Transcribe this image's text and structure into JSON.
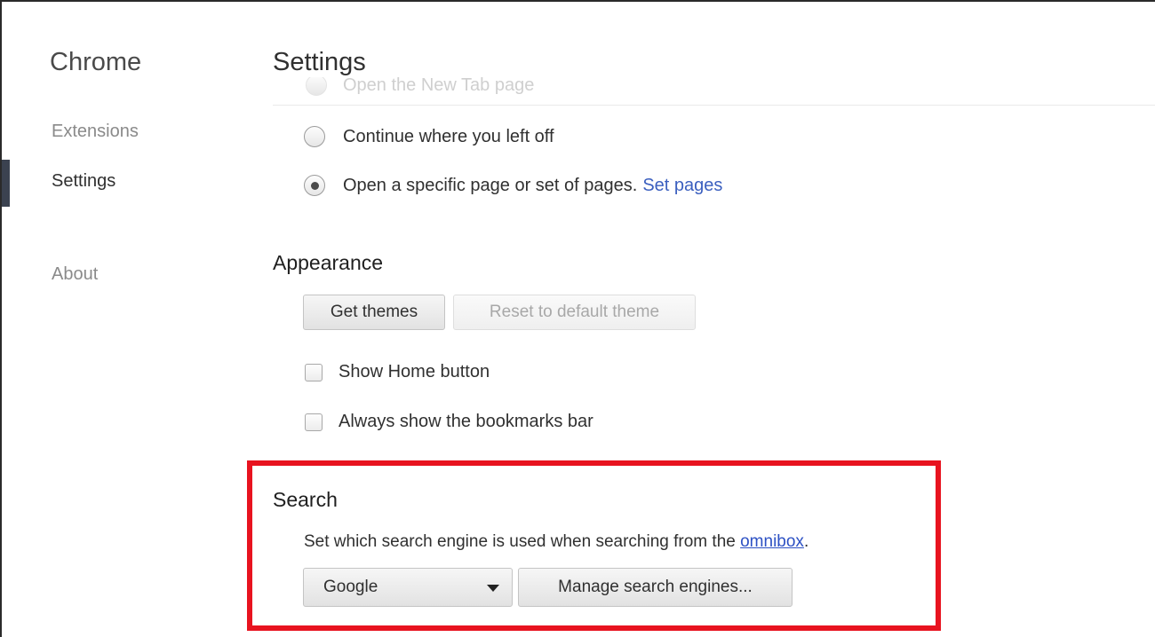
{
  "sidebar": {
    "title": "Chrome",
    "items": [
      {
        "label": "Extensions",
        "active": false
      },
      {
        "label": "Settings",
        "active": true
      },
      {
        "label": "About",
        "active": false
      }
    ]
  },
  "header": {
    "title": "Settings"
  },
  "startup": {
    "faded_option": "Open the New Tab page",
    "options": [
      {
        "label": "Continue where you left off",
        "selected": false
      },
      {
        "label": "Open a specific page or set of pages.",
        "selected": true,
        "link": "Set pages"
      }
    ]
  },
  "appearance": {
    "title": "Appearance",
    "get_themes_label": "Get themes",
    "reset_theme_label": "Reset to default theme",
    "reset_theme_disabled": true,
    "show_home_label": "Show Home button",
    "show_home_checked": false,
    "bookmarks_bar_label": "Always show the bookmarks bar",
    "bookmarks_bar_checked": false
  },
  "search": {
    "title": "Search",
    "description": "Set which search engine is used when searching from the",
    "description_link": "omnibox",
    "description_end": ".",
    "engine_selected": "Google",
    "manage_label": "Manage search engines..."
  },
  "colors": {
    "link": "#3b5fbf",
    "highlight": "#e8131f",
    "active_marker": "#3b4250"
  }
}
